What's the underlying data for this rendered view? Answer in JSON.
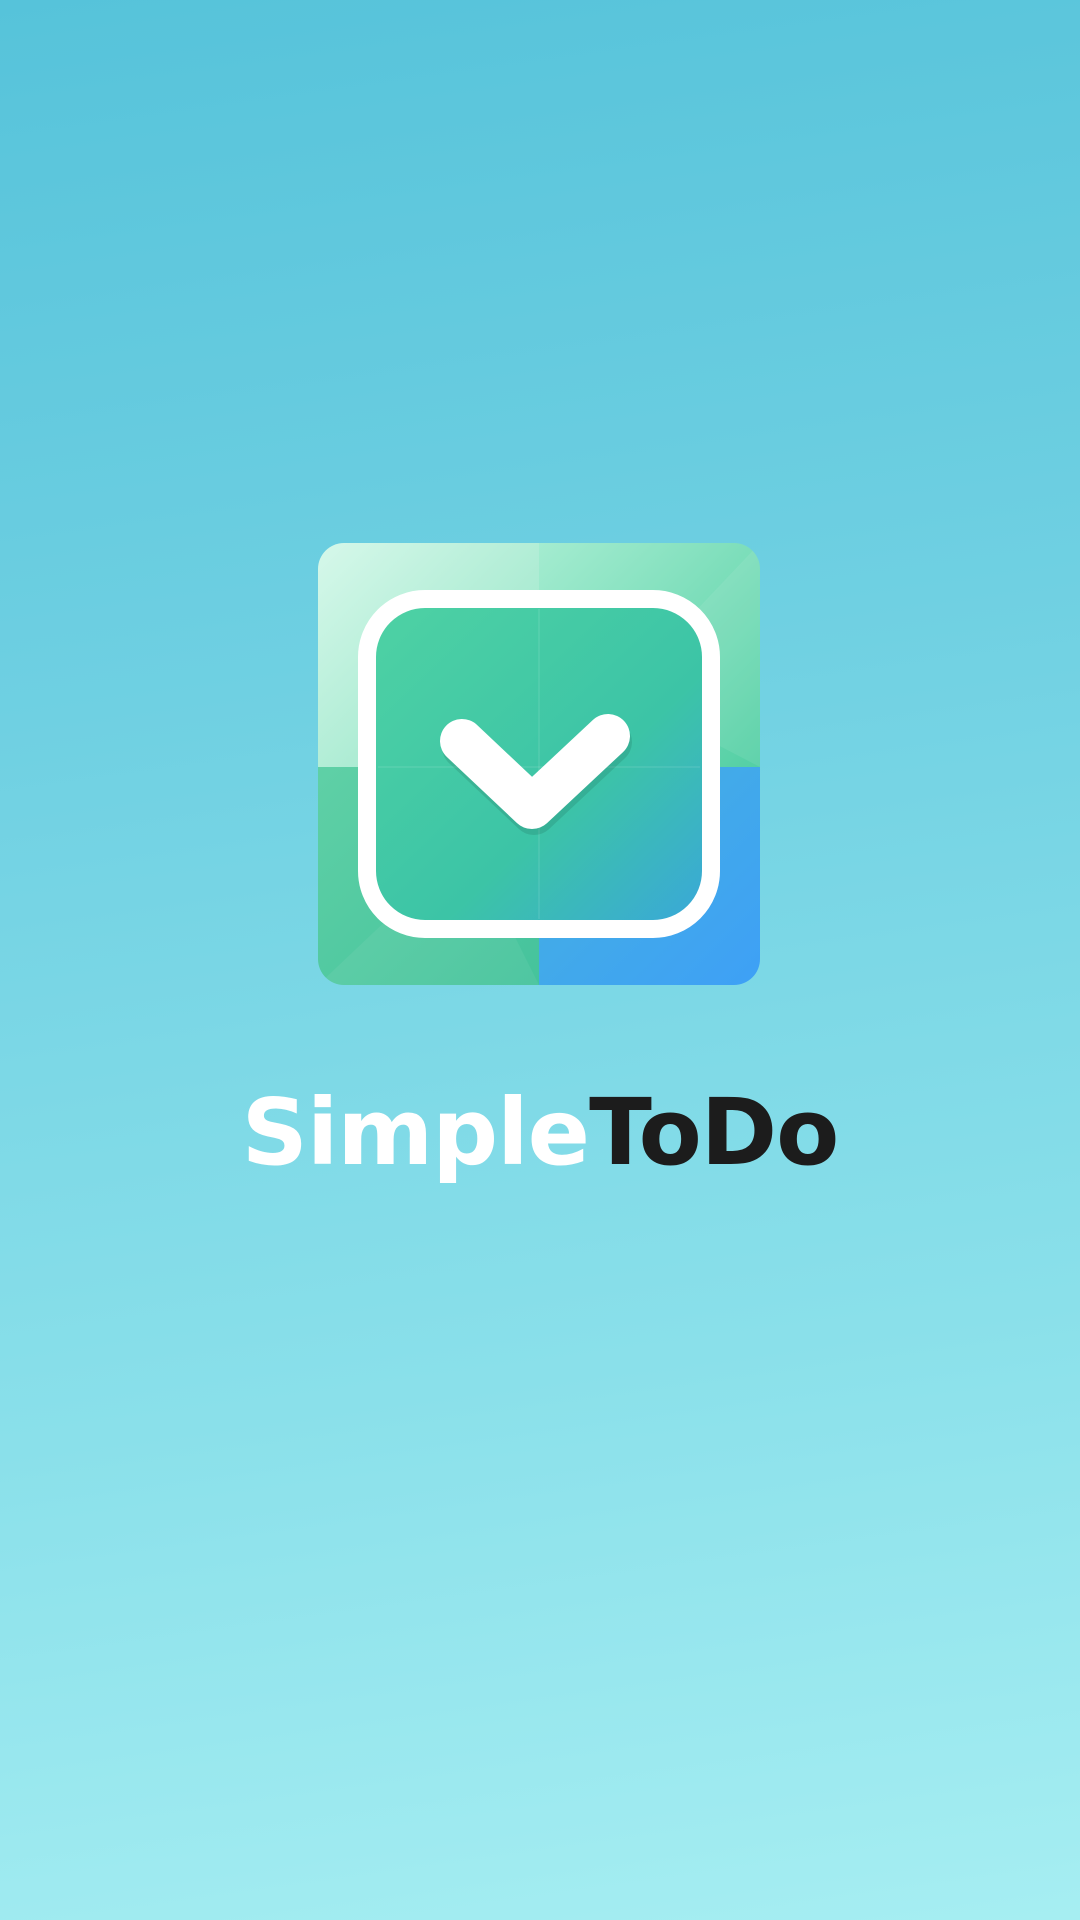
{
  "splash": {
    "app_name_part_1": "Simple",
    "app_name_part_2": "ToDo",
    "logo_icon": "checkbox-check-icon"
  },
  "colors": {
    "background_top": "#56c3da",
    "background_bottom": "#a6eef2",
    "logo_green": "#4fd1a7",
    "logo_blue": "#3fa3f2",
    "title_light": "#ffffff",
    "title_dark": "#1c1c1c"
  }
}
